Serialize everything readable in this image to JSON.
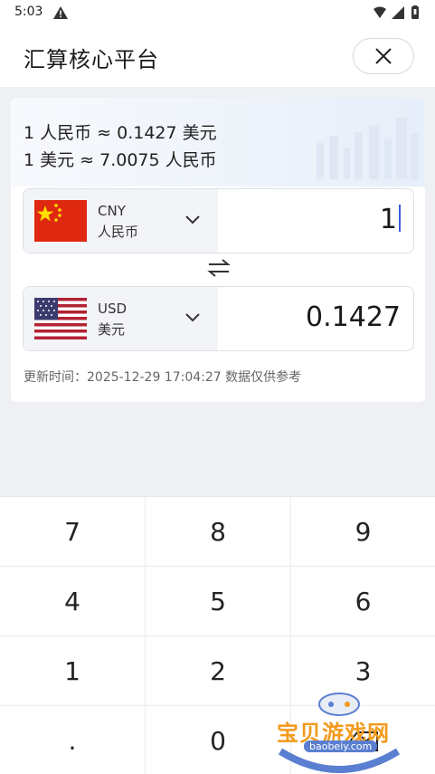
{
  "status": {
    "time": "5:03"
  },
  "header": {
    "title": "汇算核心平台"
  },
  "rates": {
    "line1": "1 人民币 ≈ 0.1427 美元",
    "line2": "1 美元 ≈ 7.0075 人民币"
  },
  "from": {
    "code": "CNY",
    "name": "人民币",
    "amount": "1"
  },
  "to": {
    "code": "USD",
    "name": "美元",
    "amount": "0.1427"
  },
  "update_text": "更新时间：2025-12-29 17:04:27 数据仅供参考",
  "keypad": {
    "k7": "7",
    "k8": "8",
    "k9": "9",
    "k4": "4",
    "k5": "5",
    "k6": "6",
    "k1": "1",
    "k2": "2",
    "k3": "3",
    "kdot": ".",
    "k0": "0"
  },
  "watermark": {
    "text": "宝贝游戏网",
    "url": "baobeiy.com"
  },
  "colors": {
    "accent": "#3a5ad9",
    "watermark": "#f29a1c"
  }
}
